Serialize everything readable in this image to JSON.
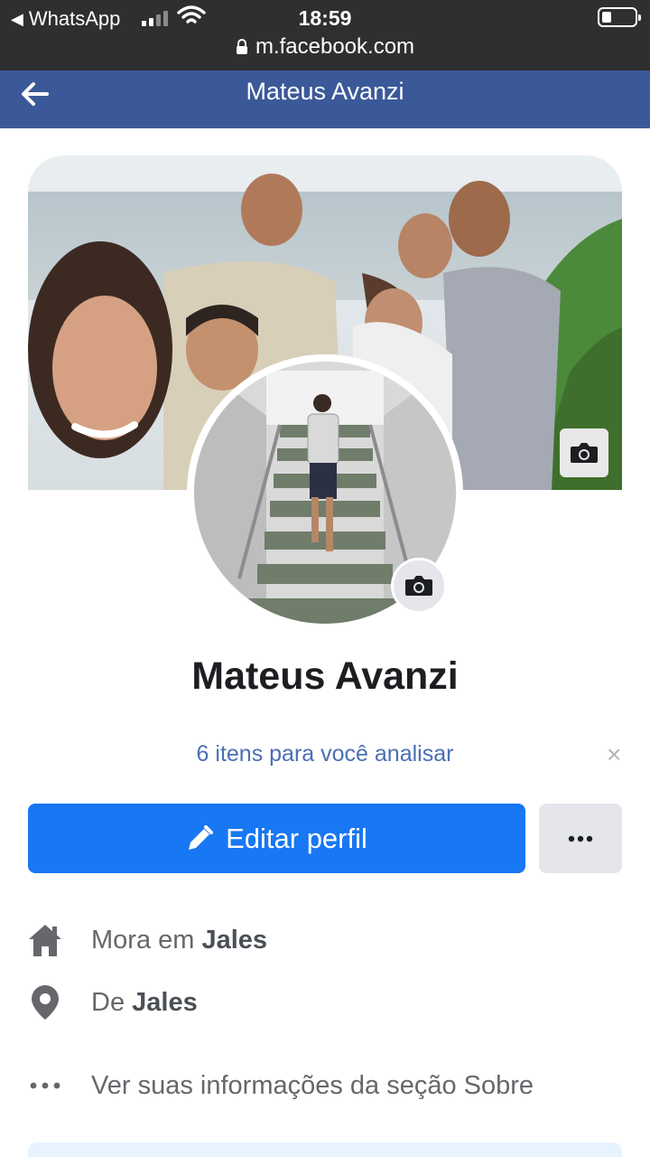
{
  "status_bar": {
    "back_app": "WhatsApp",
    "time": "18:59",
    "url": "m.facebook.com"
  },
  "header": {
    "title": "Mateus Avanzi"
  },
  "profile": {
    "name": "Mateus Avanzi",
    "review_text": "6 itens para você analisar",
    "review_close": "×",
    "edit_label": "Editar perfil"
  },
  "info": {
    "lives_prefix": "Mora em ",
    "lives_city": "Jales",
    "from_prefix": "De ",
    "from_city": "Jales",
    "about_link": "Ver suas informações da seção Sobre"
  },
  "icons": {
    "back": "arrow-left-icon",
    "cover_camera": "camera-icon",
    "avatar_camera": "camera-icon",
    "edit": "pencil-icon",
    "more": "ellipsis-icon",
    "home": "home-icon",
    "location": "location-pin-icon",
    "about": "ellipsis-icon"
  },
  "colors": {
    "fb_header": "#3b5998",
    "primary_button": "#1877f2",
    "link": "#4a6fb5"
  }
}
